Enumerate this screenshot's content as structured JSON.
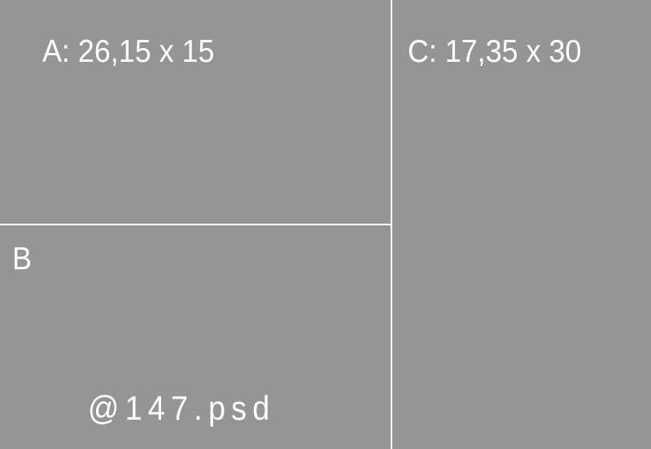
{
  "panels": {
    "a": {
      "label": "A: 26,15 x 15"
    },
    "b": {
      "label": "B"
    },
    "c": {
      "label": "C: 17,35 x 30"
    }
  },
  "file_name": "@147.psd",
  "colors": {
    "background": "#959595",
    "divider": "#ffffff",
    "text": "#ffffff"
  }
}
